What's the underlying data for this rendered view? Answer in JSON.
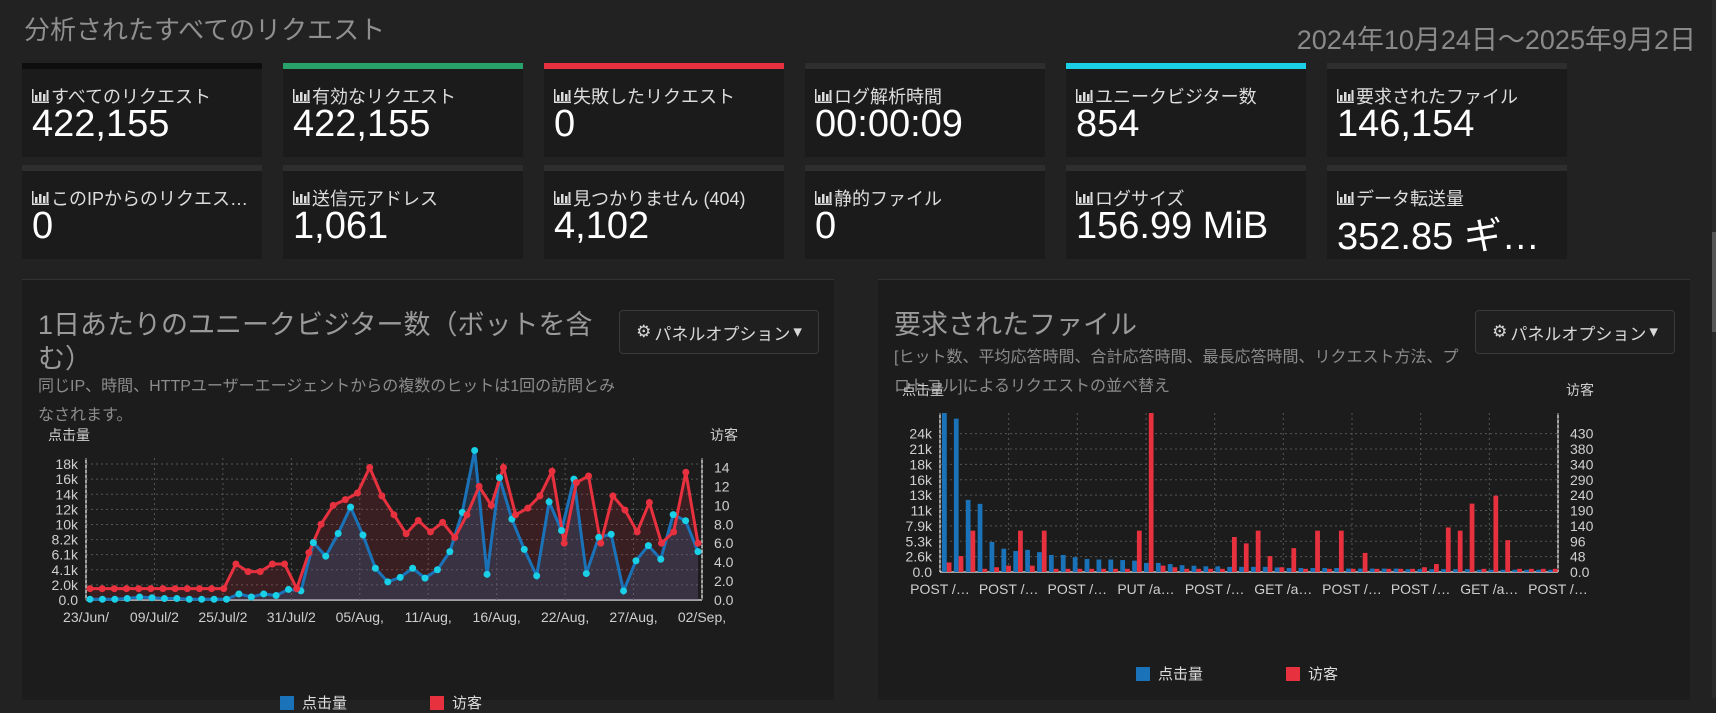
{
  "header": {
    "title": "分析されたすべてのリクエスト",
    "date_range": "2024年10月24日～2025年9月2日"
  },
  "cards": [
    {
      "label": "すべてのリクエスト",
      "value": "422,155",
      "accent": "#0e0e0e"
    },
    {
      "label": "有効なリクエスト",
      "value": "422,155",
      "accent": "#27a36a"
    },
    {
      "label": "失敗したリクエスト",
      "value": "0",
      "accent": "#e8313f"
    },
    {
      "label": "ログ解析時間",
      "value": "00:00:09",
      "accent": "#2e2e2e"
    },
    {
      "label": "ユニークビジター数",
      "value": "854",
      "accent": "#19d0e6"
    },
    {
      "label": "要求されたファイル",
      "value": "146,154",
      "accent": "#2e2e2e"
    },
    {
      "label": "このIPからのリクエス…",
      "value": "0",
      "accent": "#2e2e2e"
    },
    {
      "label": "送信元アドレス",
      "value": "1,061",
      "accent": "#2e2e2e"
    },
    {
      "label": "見つかりません (404)",
      "value": "4,102",
      "accent": "#2e2e2e"
    },
    {
      "label": "静的ファイル",
      "value": "0",
      "accent": "#2e2e2e"
    },
    {
      "label": "ログサイズ",
      "value": "156.99 MiB",
      "accent": "#2e2e2e"
    },
    {
      "label": "データ転送量",
      "value": "352.85 ギ…",
      "accent": "#2e2e2e"
    }
  ],
  "panels": [
    {
      "title": "1日あたりのユニークビジター数（ボットを含む）",
      "desc": "同じIP、時間、HTTPユーザーエージェントからの複数のヒットは1回の訪問とみなされます。",
      "options_label": "パネルオプション"
    },
    {
      "title": "要求されたファイル",
      "desc": "[ヒット数、平均応答時間、合計応答時間、最長応答時間、リクエスト方法、プロトコル]によるリクエストの並べ替え",
      "options_label": "パネルオプション"
    }
  ],
  "colors": {
    "hits": "#1a73b8",
    "visitors": "#e8313f",
    "hits_line": "#1a73b8",
    "hits_point": "#19d0e6"
  },
  "chart_data": [
    {
      "type": "line",
      "ylabel_left": "点击量",
      "ylabel_right": "访客",
      "y_ticks_left": [
        "0.0",
        "2.0k",
        "4.1k",
        "6.1k",
        "8.2k",
        "10k",
        "12k",
        "14k",
        "16k",
        "18k"
      ],
      "y_ticks_right": [
        "0.0",
        "2.0",
        "4.0",
        "6.0",
        "8.0",
        "10",
        "12",
        "14"
      ],
      "x_ticks": [
        "23/Jun/",
        "09/Jul/2",
        "25/Jul/2",
        "31/Jul/2",
        "05/Aug,",
        "11/Aug,",
        "16/Aug,",
        "22/Aug,",
        "27/Aug,",
        "02/Sep,"
      ],
      "ylim_left": [
        0,
        18800
      ],
      "ylim_right": [
        0,
        15
      ],
      "grid": true,
      "legend": [
        "点击量",
        "访客"
      ],
      "series": [
        {
          "name": "点击量",
          "values": [
            100,
            100,
            100,
            200,
            400,
            300,
            200,
            200,
            100,
            100,
            100,
            100,
            800,
            400,
            800,
            600,
            1400,
            1200,
            7600,
            5800,
            8800,
            12300,
            8600,
            4200,
            2400,
            3000,
            4200,
            2900,
            4000,
            6400,
            11600,
            19800,
            3400,
            16200,
            10700,
            6700,
            3200,
            13000,
            9200,
            16000,
            3500,
            8300,
            8700,
            1200,
            5200,
            7200,
            5400,
            11300,
            10500,
            6400
          ]
        },
        {
          "name": "访客",
          "values": [
            1.2,
            1.2,
            1.2,
            1.2,
            1.2,
            1.2,
            1.2,
            1.2,
            1.2,
            1.2,
            1.2,
            1.2,
            3.8,
            3.0,
            3.0,
            3.8,
            3.8,
            1.2,
            5.0,
            8.0,
            10.0,
            10.6,
            11.3,
            14.0,
            11.0,
            9.0,
            7.0,
            8.4,
            7.2,
            8.2,
            6.6,
            9.0,
            12.0,
            10.0,
            14.0,
            9.0,
            9.7,
            11.0,
            13.6,
            6.0,
            12.4,
            13.1,
            6.0,
            11.0,
            9.5,
            7.2,
            10.3,
            6.0,
            7.2,
            13.5,
            6.0
          ]
        }
      ]
    },
    {
      "type": "bar",
      "ylabel_left": "点击量",
      "ylabel_right": "访客",
      "y_ticks_left": [
        "0.0",
        "2.6k",
        "5.3k",
        "7.9k",
        "11k",
        "13k",
        "16k",
        "18k",
        "21k",
        "24k"
      ],
      "y_ticks_right": [
        "0.0",
        "48",
        "96",
        "140",
        "190",
        "240",
        "290",
        "340",
        "380",
        "430"
      ],
      "x_ticks": [
        "POST /…",
        "POST /…",
        "POST /…",
        "PUT /a…",
        "POST /…",
        "GET /a…",
        "POST /…",
        "POST /…",
        "GET /a…",
        "POST /…"
      ],
      "ylim_left": [
        0,
        28000
      ],
      "ylim_right": [
        0,
        500
      ],
      "grid": true,
      "legend": [
        "点击量",
        "访客"
      ],
      "series": [
        {
          "name": "点击量",
          "values": [
            28000,
            27000,
            12700,
            12000,
            5300,
            4100,
            3700,
            3900,
            3500,
            3000,
            3000,
            2600,
            2300,
            2200,
            2200,
            2100,
            2000,
            1600,
            1600,
            1400,
            1200,
            1100,
            1000,
            1000,
            900,
            900,
            900,
            900,
            800,
            700,
            700,
            700,
            700,
            700,
            600,
            600,
            600,
            600,
            600,
            500,
            500,
            500,
            500,
            500,
            500,
            400,
            400,
            400,
            400,
            400,
            400,
            400
          ]
        },
        {
          "name": "访客",
          "values": [
            30,
            50,
            130,
            10,
            15,
            20,
            130,
            20,
            130,
            10,
            10,
            10,
            10,
            10,
            10,
            10,
            130,
            500,
            20,
            15,
            10,
            10,
            10,
            10,
            110,
            90,
            130,
            50,
            15,
            75,
            10,
            130,
            10,
            130,
            10,
            60,
            10,
            10,
            10,
            10,
            15,
            25,
            140,
            130,
            215,
            10,
            240,
            100,
            10,
            10,
            10,
            10
          ]
        }
      ]
    }
  ]
}
